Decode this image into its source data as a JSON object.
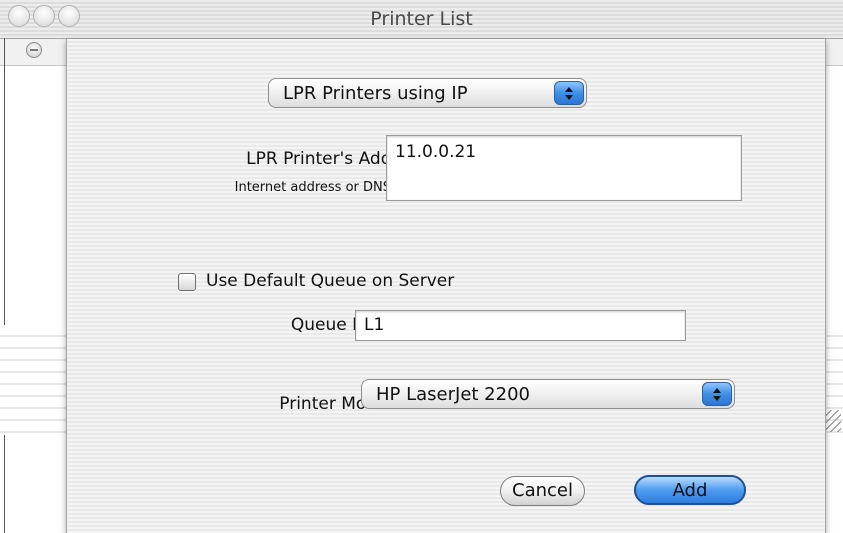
{
  "window": {
    "title": "Printer List"
  },
  "connection_type": {
    "selected": "LPR Printers using IP"
  },
  "address": {
    "label": "LPR Printer's Address:",
    "hint": "Internet address or DNS name",
    "value": "11.0.0.21"
  },
  "queue": {
    "use_default_label": "Use Default Queue on Server",
    "use_default_checked": false,
    "name_label": "Queue Name:",
    "name_value": "L1"
  },
  "model": {
    "label": "Printer Model:",
    "selected": "HP LaserJet 2200"
  },
  "buttons": {
    "cancel": "Cancel",
    "add": "Add"
  }
}
